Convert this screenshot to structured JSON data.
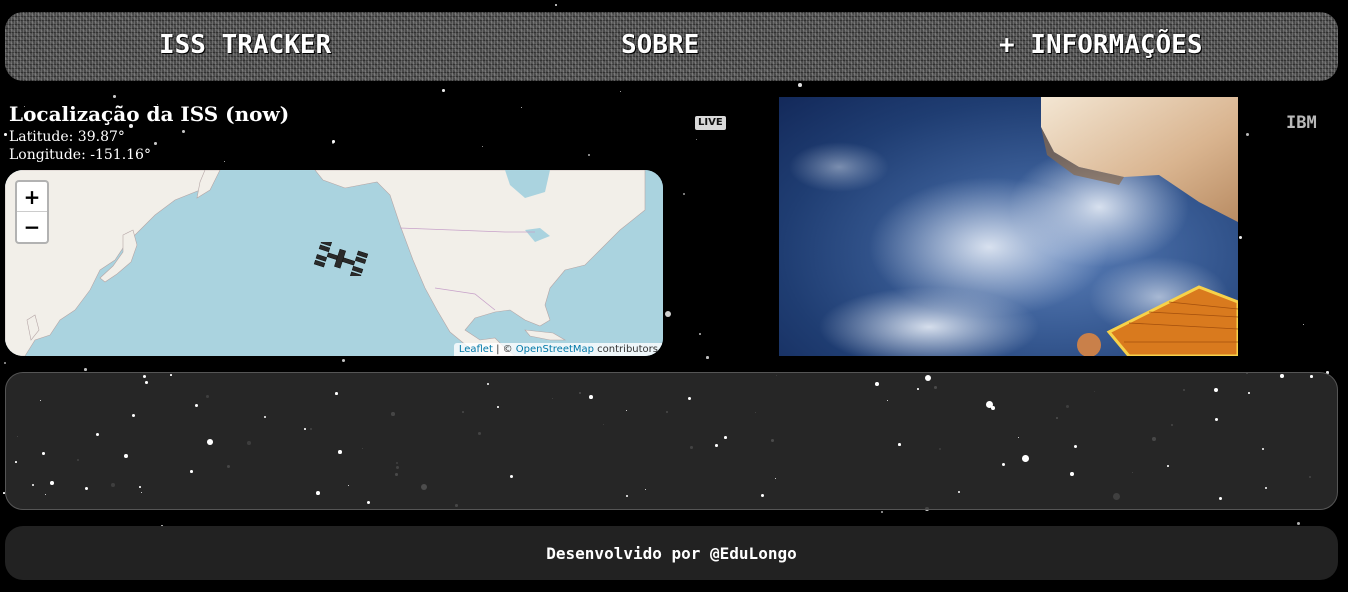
{
  "nav": {
    "tracker_label": "ISS TRACKER",
    "about_label": "SOBRE",
    "info_label": "+ INFORMAÇÕES"
  },
  "location": {
    "title": "Localização da ISS (now)",
    "latitude_text": "Latitude: 39.87°",
    "longitude_text": "Longitude: -151.16°",
    "latitude": 39.87,
    "longitude": -151.16
  },
  "map": {
    "zoom_in": "+",
    "zoom_out": "−",
    "attribution_leaflet": "Leaflet",
    "attribution_sep": " | © ",
    "attribution_osm": "OpenStreetMap",
    "attribution_tail": " contributors",
    "marker_icon": "iss-satellite-icon",
    "water_color": "#aad3df",
    "land_color": "#f2efe9"
  },
  "stream": {
    "live_badge": "LIVE",
    "brand": "IBM"
  },
  "footer": {
    "credit": "Desenvolvido por @EduLongo"
  }
}
